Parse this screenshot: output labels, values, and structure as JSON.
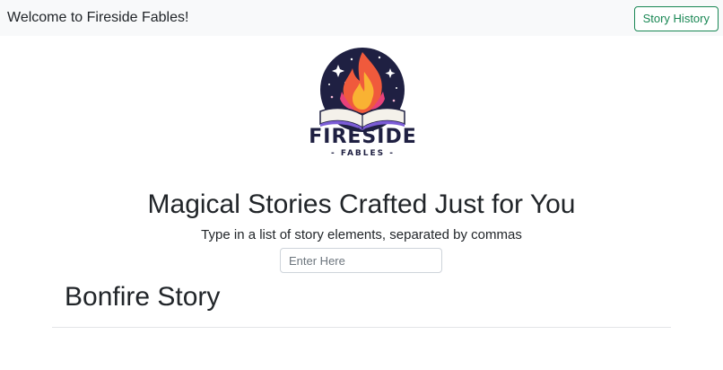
{
  "navbar": {
    "welcome_text": "Welcome to Fireside Fables!",
    "history_button_label": "Story History"
  },
  "logo": {
    "word_main": "FIRESIDE",
    "word_sub": "- FABLES -",
    "colors": {
      "circle": "#1f2042",
      "flame_outer": "#f05a3c",
      "flame_inner": "#f9b233",
      "book_pages": "#f4f1ea",
      "book_accent": "#7b5cd6"
    }
  },
  "main": {
    "headline": "Magical Stories Crafted Just for You",
    "instructions": "Type in a list of story elements, separated by commas",
    "input": {
      "placeholder": "Enter Here",
      "value": ""
    },
    "story_title": "Bonfire Story"
  },
  "colors": {
    "navbar_bg": "#f8f9fa",
    "button_accent": "#198754",
    "text": "#212529"
  }
}
